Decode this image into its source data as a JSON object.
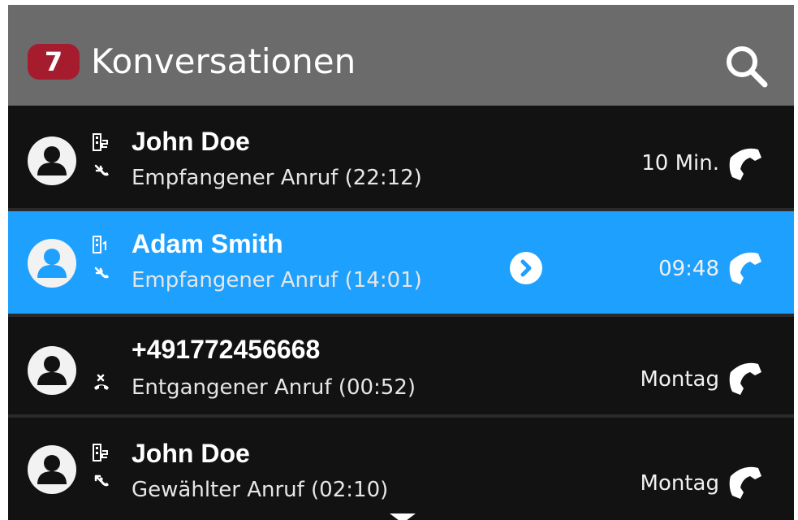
{
  "header": {
    "badge_count": "7",
    "title": "Konversationen",
    "search_icon": "search-icon"
  },
  "conversations": [
    {
      "name": "John Doe",
      "detail": "Empfangener Anruf (22:12)",
      "time": "10 Min.",
      "type_icon": "building-2-icon",
      "direction_icon": "incoming-call-icon",
      "selected": false
    },
    {
      "name": "Adam Smith",
      "detail": "Empfangener Anruf (14:01)",
      "time": "09:48",
      "type_icon": "building-1-icon",
      "direction_icon": "incoming-call-icon",
      "selected": true
    },
    {
      "name": "+491772456668",
      "detail": "Entgangener Anruf (00:52)",
      "time": "Montag",
      "type_icon": "",
      "direction_icon": "missed-call-icon",
      "selected": false
    },
    {
      "name": "John Doe",
      "detail": "Gewählter Anruf (02:10)",
      "time": "Montag",
      "type_icon": "building-2-icon",
      "direction_icon": "outgoing-call-icon",
      "selected": false
    }
  ],
  "colors": {
    "header_bg": "#6b6b6b",
    "badge_bg": "#a61c2f",
    "selected_bg": "#1ea0ff",
    "row_bg": "#121212"
  }
}
